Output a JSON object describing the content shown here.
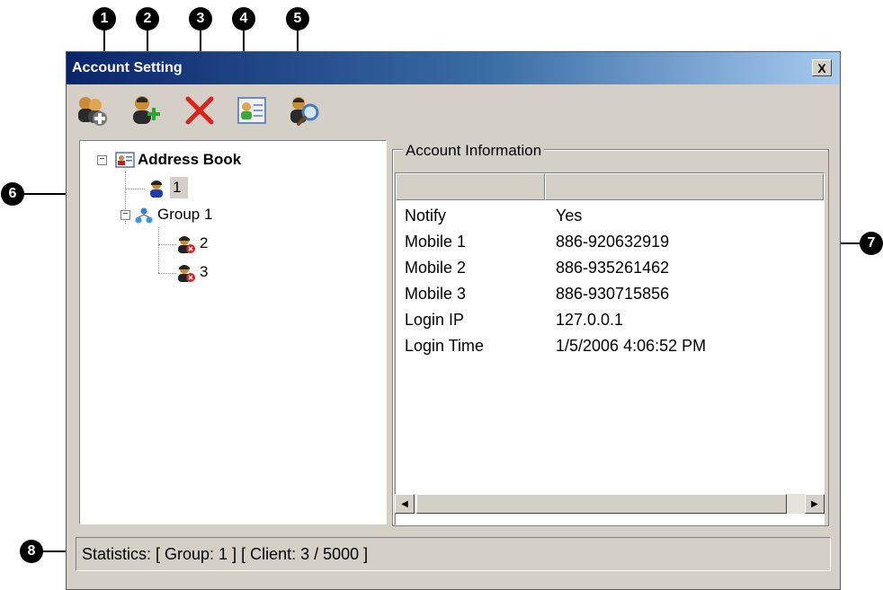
{
  "callouts": [
    "1",
    "2",
    "3",
    "4",
    "5",
    "6",
    "7",
    "8"
  ],
  "window": {
    "title": "Account Setting",
    "close_label": "X"
  },
  "toolbar": {
    "buttons": [
      {
        "icon": "add-account-icon"
      },
      {
        "icon": "add-user-icon"
      },
      {
        "icon": "delete-icon"
      },
      {
        "icon": "contact-card-icon"
      },
      {
        "icon": "search-user-icon"
      }
    ]
  },
  "tree": {
    "root": "Address Book",
    "nodes": [
      {
        "label": "1",
        "icon": "user-icon",
        "selected": true
      },
      {
        "label": "Group 1",
        "icon": "group-icon"
      },
      {
        "label": "2",
        "icon": "user-offline-icon"
      },
      {
        "label": "3",
        "icon": "user-offline-icon"
      }
    ]
  },
  "info": {
    "group_title": "Account Information",
    "rows": [
      {
        "key": "Notify",
        "value": "Yes"
      },
      {
        "key": "Mobile 1",
        "value": "886-920632919"
      },
      {
        "key": "Mobile 2",
        "value": "886-935261462"
      },
      {
        "key": "Mobile 3",
        "value": "886-930715856"
      },
      {
        "key": "Login IP",
        "value": "127.0.0.1"
      },
      {
        "key": "Login Time",
        "value": "1/5/2006 4:06:52 PM"
      }
    ]
  },
  "status": {
    "text": "Statistics:  [ Group: 1 ]  [ Client: 3 / 5000 ]"
  },
  "colors": {
    "title_start": "#0a246a",
    "title_end": "#a6caf0",
    "face": "#d4d0c8",
    "delete_red": "#e0201a"
  }
}
